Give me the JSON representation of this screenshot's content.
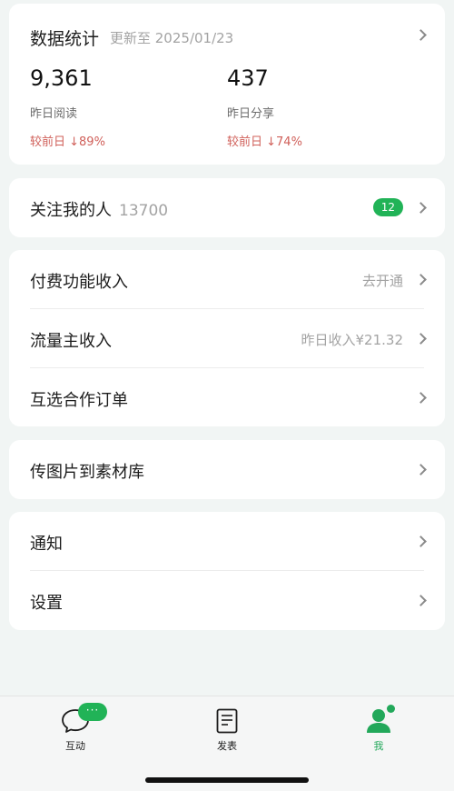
{
  "stats": {
    "title": "数据统计",
    "updated": "更新至 2025/01/23",
    "items": [
      {
        "value": "9,361",
        "label": "昨日阅读",
        "compare": "较前日 ↓89%"
      },
      {
        "value": "437",
        "label": "昨日分享",
        "compare": "较前日 ↓74%"
      }
    ]
  },
  "followers": {
    "label": "关注我的人",
    "count": "13700",
    "badge": "12"
  },
  "income": {
    "paid": {
      "label": "付费功能收入",
      "value": "去开通"
    },
    "traffic": {
      "label": "流量主收入",
      "value": "昨日收入¥21.32"
    },
    "orders": {
      "label": "互选合作订单"
    }
  },
  "upload": {
    "label": "传图片到素材库"
  },
  "misc": {
    "notify": "通知",
    "settings": "设置"
  },
  "tabbar": {
    "chat_badge": "···",
    "tabs": [
      {
        "label": "互动"
      },
      {
        "label": "发表"
      },
      {
        "label": "我"
      }
    ],
    "accent": "#22a85a"
  }
}
